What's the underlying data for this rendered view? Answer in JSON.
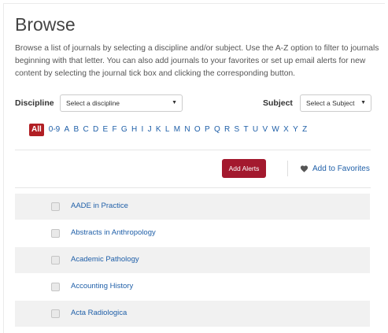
{
  "page": {
    "title": "Browse",
    "intro": "Browse a list of journals by selecting a discipline and/or subject. Use the A-Z option to filter to journals beginning with that letter. You can also add journals to your favorites or set up email alerts for new content by selecting the journal tick box and clicking the corresponding button."
  },
  "filters": {
    "discipline_label": "Discipline",
    "discipline_value": "Select a discipline",
    "subject_label": "Subject",
    "subject_value": "Select a Subject"
  },
  "az": {
    "selected": "All",
    "letters": [
      "All",
      "0-9",
      "A",
      "B",
      "C",
      "D",
      "E",
      "F",
      "G",
      "H",
      "I",
      "J",
      "K",
      "L",
      "M",
      "N",
      "O",
      "P",
      "Q",
      "R",
      "S",
      "T",
      "U",
      "V",
      "W",
      "X",
      "Y",
      "Z"
    ]
  },
  "actions": {
    "add_alerts_label": "Add Alerts",
    "add_favorites_label": "Add to Favorites"
  },
  "journals": [
    "AADE in Practice",
    "Abstracts in Anthropology",
    "Academic Pathology",
    "Accounting History",
    "Acta Radiologica"
  ],
  "colors": {
    "accent_red": "#a3192e",
    "link_blue": "#1f5fa8",
    "row_shade": "#f1f1f1"
  }
}
